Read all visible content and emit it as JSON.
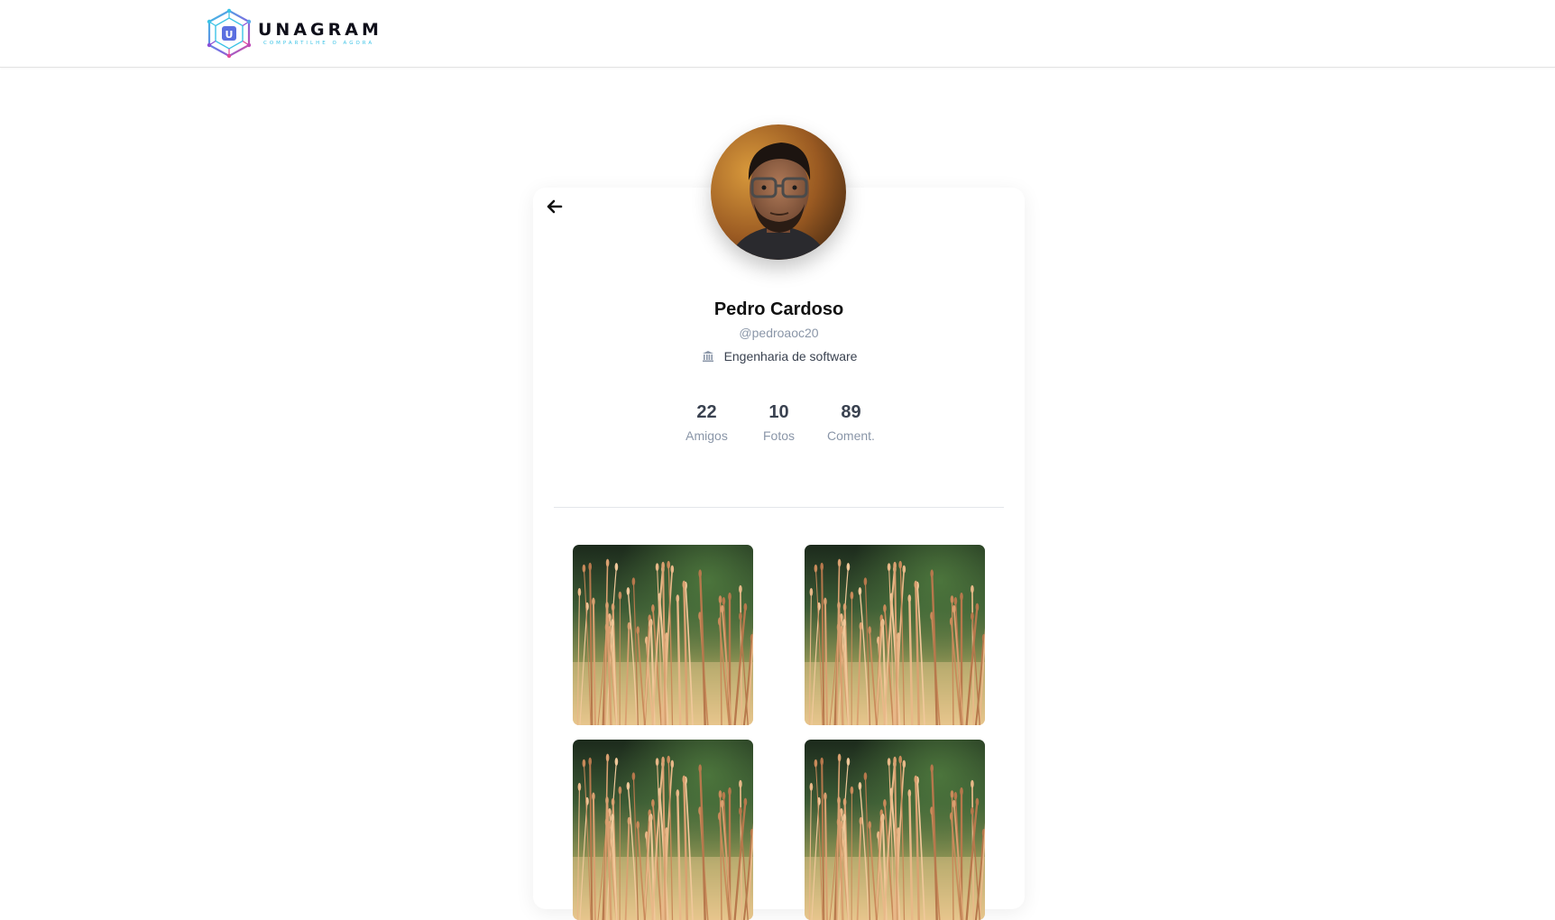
{
  "header": {
    "brand_name": "UNAGRAM",
    "brand_tagline": "COMPARTILHE O AGORA",
    "logo_letter": "U"
  },
  "profile": {
    "name": "Pedro Cardoso",
    "handle": "@pedroaoc20",
    "course": "Engenharia de software",
    "stats": [
      {
        "value": "22",
        "label": "Amigos"
      },
      {
        "value": "10",
        "label": "Fotos"
      },
      {
        "value": "89",
        "label": "Coment."
      }
    ]
  },
  "icons": {
    "back": "arrow-left-icon",
    "course": "institution-icon"
  },
  "colors": {
    "brand_cyan": "#3cc3e6",
    "brand_purple": "#8a4fd8",
    "brand_pink": "#e0489a",
    "text_muted": "#8a96a8",
    "text_dark": "#3a4250"
  },
  "gallery": {
    "photos": [
      "grass-photo",
      "grass-photo",
      "grass-photo",
      "grass-photo"
    ]
  }
}
